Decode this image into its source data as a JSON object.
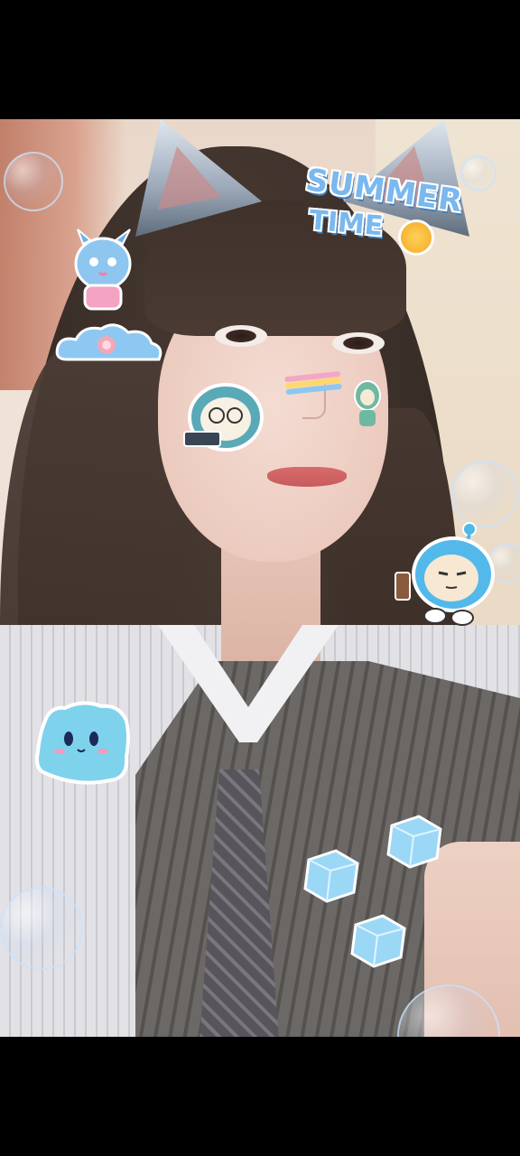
{
  "viewer": {
    "mode": "fullscreen-photo",
    "background_color": "#000000"
  },
  "photo": {
    "description_color_palette": {
      "hair": "#3b2f29",
      "skin": "#f4dcd3",
      "shirt": "#e2e2e6",
      "vest": "#6c6865",
      "sticker_blue": "#7ab8ee"
    }
  },
  "stickers": {
    "summer_time": {
      "line1": "SUMMER",
      "line2": "TIME",
      "text_color": "#7ab8ee",
      "outline_color": "#3c7fc0"
    },
    "icons": [
      "monster-sticker",
      "cloud-sticker",
      "rainbow-sticker",
      "glasses-character-sticker",
      "small-alien-sticker",
      "blue-hooded-character-sticker",
      "slime-sticker",
      "ice-cube-sticker",
      "bubble"
    ]
  }
}
